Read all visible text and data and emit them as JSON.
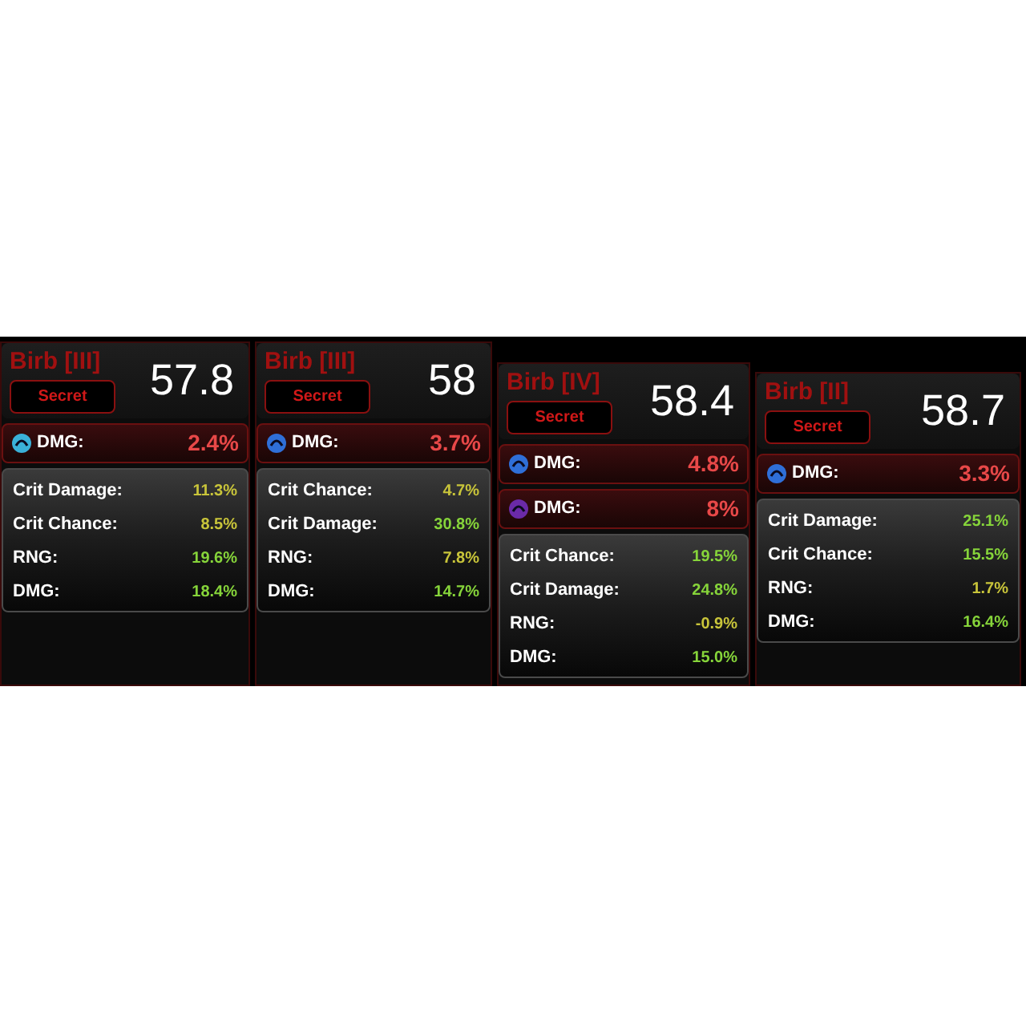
{
  "cards": [
    {
      "name": "Birb [III]",
      "rarity": "Secret",
      "score": "57.8",
      "abilities": [
        {
          "label": "DMG:",
          "value": "2.4%",
          "color": "#3ab0d8"
        }
      ],
      "stats": [
        {
          "label": "Crit Damage:",
          "value": "11.3%",
          "color": "#c8c43a"
        },
        {
          "label": "Crit Chance:",
          "value": "8.5%",
          "color": "#c8c43a"
        },
        {
          "label": "RNG:",
          "value": "19.6%",
          "color": "#86d43a"
        },
        {
          "label": "DMG:",
          "value": "18.4%",
          "color": "#86d43a"
        }
      ]
    },
    {
      "name": "Birb [III]",
      "rarity": "Secret",
      "score": "58",
      "abilities": [
        {
          "label": "DMG:",
          "value": "3.7%",
          "color": "#2f6fd8"
        }
      ],
      "stats": [
        {
          "label": "Crit Chance:",
          "value": "4.7%",
          "color": "#c8c43a"
        },
        {
          "label": "Crit Damage:",
          "value": "30.8%",
          "color": "#86d43a"
        },
        {
          "label": "RNG:",
          "value": "7.8%",
          "color": "#c8c43a"
        },
        {
          "label": "DMG:",
          "value": "14.7%",
          "color": "#86d43a"
        }
      ]
    },
    {
      "name": "Birb [IV]",
      "rarity": "Secret",
      "score": "58.4",
      "abilities": [
        {
          "label": "DMG:",
          "value": "4.8%",
          "color": "#2f6fd8"
        },
        {
          "label": "DMG:",
          "value": "8%",
          "color": "#6a2aa8"
        }
      ],
      "stats": [
        {
          "label": "Crit Chance:",
          "value": "19.5%",
          "color": "#86d43a"
        },
        {
          "label": "Crit Damage:",
          "value": "24.8%",
          "color": "#86d43a"
        },
        {
          "label": "RNG:",
          "value": "-0.9%",
          "color": "#c8c43a"
        },
        {
          "label": "DMG:",
          "value": "15.0%",
          "color": "#86d43a"
        }
      ]
    },
    {
      "name": "Birb [II]",
      "rarity": "Secret",
      "score": "58.7",
      "abilities": [
        {
          "label": "DMG:",
          "value": "3.3%",
          "color": "#2f6fd8"
        }
      ],
      "stats": [
        {
          "label": "Crit Damage:",
          "value": "25.1%",
          "color": "#86d43a"
        },
        {
          "label": "Crit Chance:",
          "value": "15.5%",
          "color": "#86d43a"
        },
        {
          "label": "RNG:",
          "value": "1.7%",
          "color": "#c8c43a"
        },
        {
          "label": "DMG:",
          "value": "16.4%",
          "color": "#86d43a"
        }
      ]
    }
  ]
}
